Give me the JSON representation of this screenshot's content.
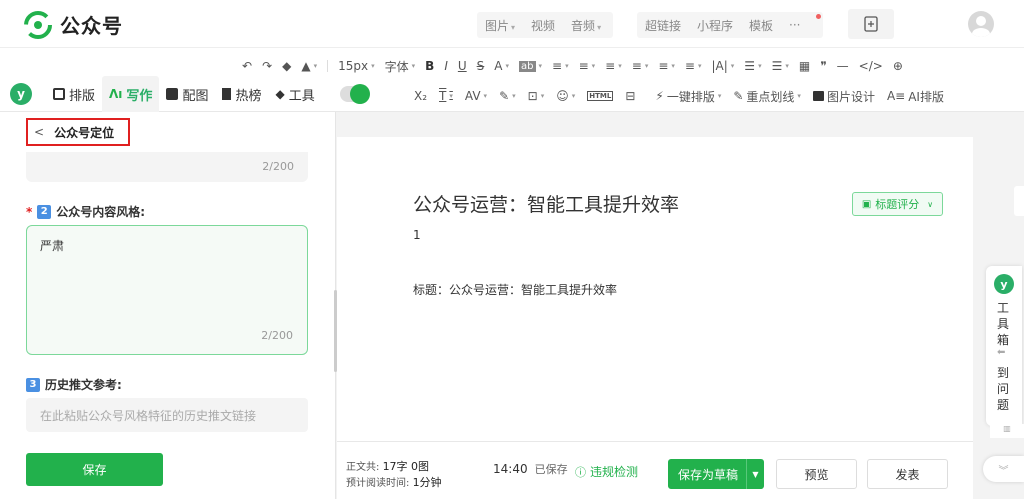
{
  "header": {
    "logo_text": "公众号",
    "groups": [
      [
        "图片",
        "视频",
        "音频"
      ],
      [
        "超链接",
        "小程序",
        "模板",
        "···"
      ]
    ]
  },
  "toolbar": {
    "row1": [
      "↶",
      "↷",
      "◆",
      "▲",
      "15px",
      "字体",
      "B",
      "I",
      "U",
      "S",
      "A",
      "ab",
      "≡",
      "≡",
      "≡",
      "≡",
      "≡",
      "≡",
      "|A|",
      "☰",
      "☰",
      "▦",
      "❞",
      "—",
      "</>",
      "⊕"
    ],
    "row2": [
      "X₂",
      "T",
      "AV",
      "✎",
      "⊡",
      "☺",
      "HTML",
      "⊟"
    ],
    "row2_actions": [
      "一键排版",
      "重点划线",
      "图片设计",
      "AI排版"
    ]
  },
  "tabs": [
    "排版",
    "写作",
    "配图",
    "热榜",
    "工具"
  ],
  "left_panel": {
    "back_label": "公众号定位",
    "counter_top": "2/200",
    "style_label": "公众号内容风格:",
    "style_num": "2",
    "style_value": "严肃",
    "style_counter": "2/200",
    "history_label": "历史推文参考:",
    "history_num": "3",
    "history_placeholder": "在此粘贴公众号风格特征的历史推文链接",
    "save_label": "保存"
  },
  "editor": {
    "title": "公众号运营：智能工具提升效率",
    "line1": "1",
    "line2": "标题：公众号运营：智能工具提升效率",
    "score_label": "标题评分"
  },
  "bottom": {
    "word_count_label": "正文共:",
    "word_count": "17字 0图",
    "read_time_label": "预计阅读时间:",
    "read_time": "1分钟",
    "save_time": "14:40",
    "save_status": "已保存",
    "check_label": "违规检测",
    "draft_label": "保存为草稿",
    "preview_label": "预览",
    "publish_label": "发表"
  },
  "right_float": {
    "tools_label": "工具箱",
    "problem_label": "到问题"
  },
  "colors": {
    "brand": "#22b14c",
    "highlight": "#e02020"
  }
}
